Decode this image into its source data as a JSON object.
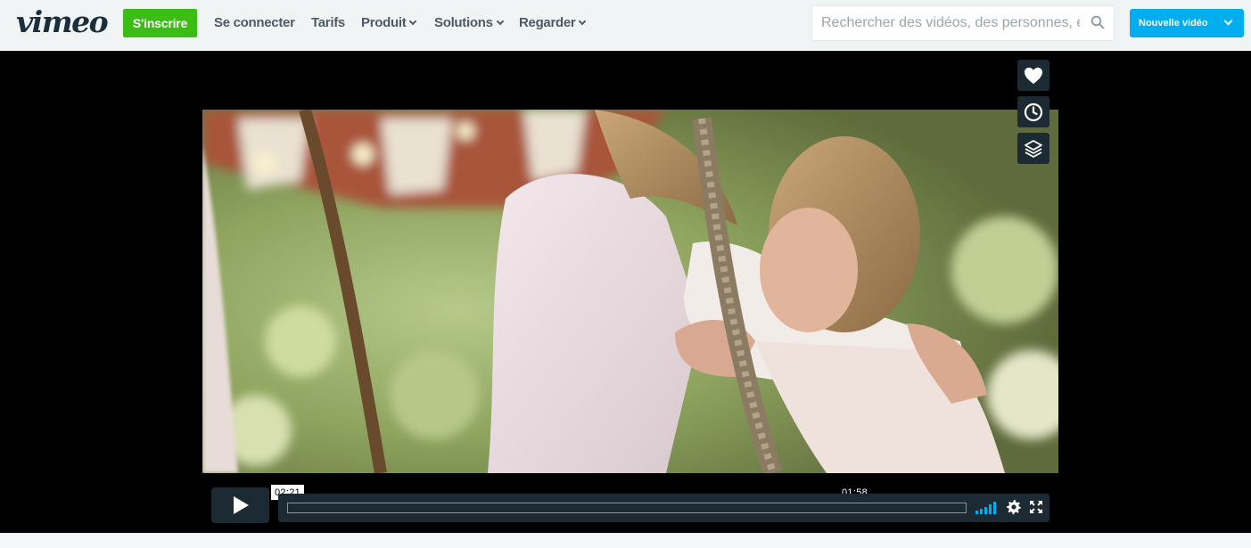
{
  "nav": {
    "logo": "vimeo",
    "signup": "S'inscrire",
    "login": "Se connecter",
    "pricing": "Tarifs",
    "product": "Produit",
    "solutions": "Solutions",
    "watch": "Regarder",
    "search_placeholder": "Rechercher des vidéos, des personnes, et plus",
    "new_video": "Nouvelle vidéo"
  },
  "player": {
    "current_time": "02:21",
    "hover_time": "01:58",
    "side_actions": [
      "heart-icon",
      "clock-icon",
      "layers-icon"
    ],
    "volume_level": 1.0
  },
  "colors": {
    "brand_green": "#3cbd16",
    "brand_blue": "#00adef",
    "player_controls": "#1b2a33",
    "volume_bars": "#00adef"
  }
}
